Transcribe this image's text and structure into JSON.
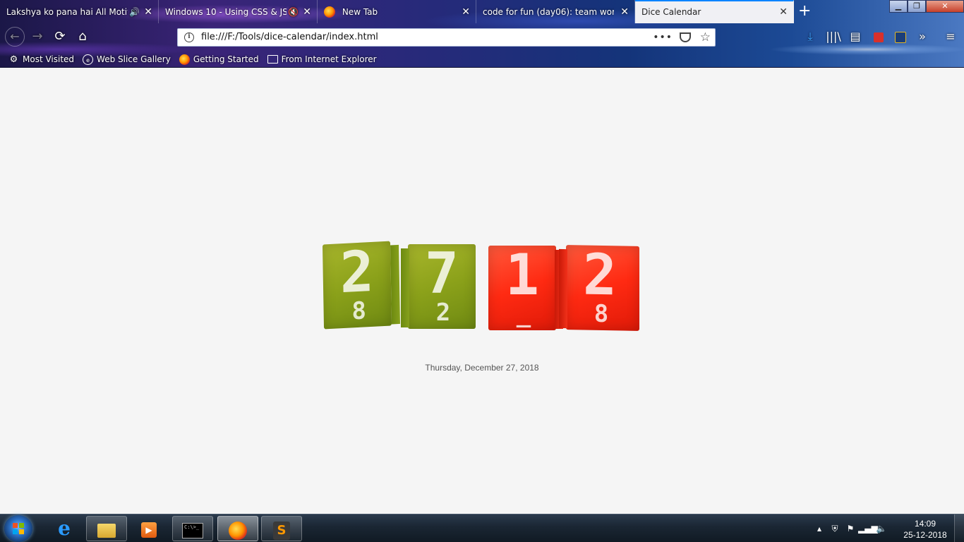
{
  "browser": {
    "tabs": [
      {
        "title": "Lakshya ko pana hai All Motivati",
        "audio_icon": "speaker-icon",
        "active": false
      },
      {
        "title": "Windows 10 - Using CSS & JS Or",
        "audio_icon": "muted-speaker-icon",
        "active": false
      },
      {
        "title": "New Tab",
        "audio_icon": null,
        "active": false
      },
      {
        "title": "code for fun (day06): team working",
        "audio_icon": null,
        "active": false
      },
      {
        "title": "Dice Calendar",
        "audio_icon": null,
        "active": true
      }
    ],
    "url": "file:///F:/Tools/dice-calendar/index.html",
    "bookmarks": [
      {
        "label": "Most Visited",
        "icon": "gear-icon"
      },
      {
        "label": "Web Slice Gallery",
        "icon": "globe-icon"
      },
      {
        "label": "Getting Started",
        "icon": "firefox-icon"
      },
      {
        "label": "From Internet Explorer",
        "icon": "folder-icon"
      }
    ],
    "accent_color": "#0a84ff"
  },
  "page": {
    "dice": [
      {
        "digit": "2",
        "sub": "8",
        "color": "#8ba11a"
      },
      {
        "digit": "7",
        "sub": "2",
        "color": "#8ba11a"
      },
      {
        "digit": "1",
        "sub": "_",
        "color": "#ff2a12"
      },
      {
        "digit": "2",
        "sub": "8",
        "color": "#ff2a12"
      }
    ],
    "date_text": "Thursday, December 27, 2018"
  },
  "taskbar": {
    "clock_time": "14:09",
    "clock_date": "25-12-2018",
    "cmd_prompt": "C:\\>_"
  }
}
